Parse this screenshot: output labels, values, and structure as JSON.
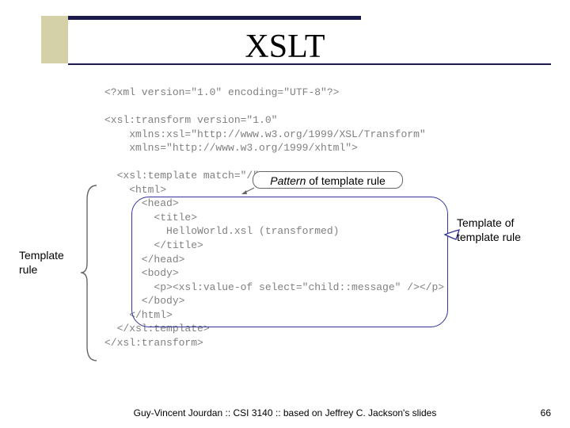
{
  "title": "XSLT",
  "code": "<?xml version=\"1.0\" encoding=\"UTF-8\"?>\n\n<xsl:transform version=\"1.0\"\n    xmlns:xsl=\"http://www.w3.org/1999/XSL/Transform\"\n    xmlns=\"http://www.w3.org/1999/xhtml\">\n\n  <xsl:template match=\"/\">\n    <html>\n      <head>\n        <title>\n          HelloWorld.xsl (transformed)\n        </title>\n      </head>\n      <body>\n        <p><xsl:value-of select=\"child::message\" /></p>\n      </body>\n    </html>\n  </xsl:template>\n</xsl:transform>",
  "callouts": {
    "pattern_prefix_italic": "Pattern",
    "pattern_suffix": " of template rule",
    "template_of_template": "Template of template rule",
    "template_rule": "Template rule"
  },
  "footer": {
    "text": "Guy-Vincent Jourdan :: CSI 3140 :: based on Jeffrey C. Jackson's slides",
    "page": "66"
  }
}
